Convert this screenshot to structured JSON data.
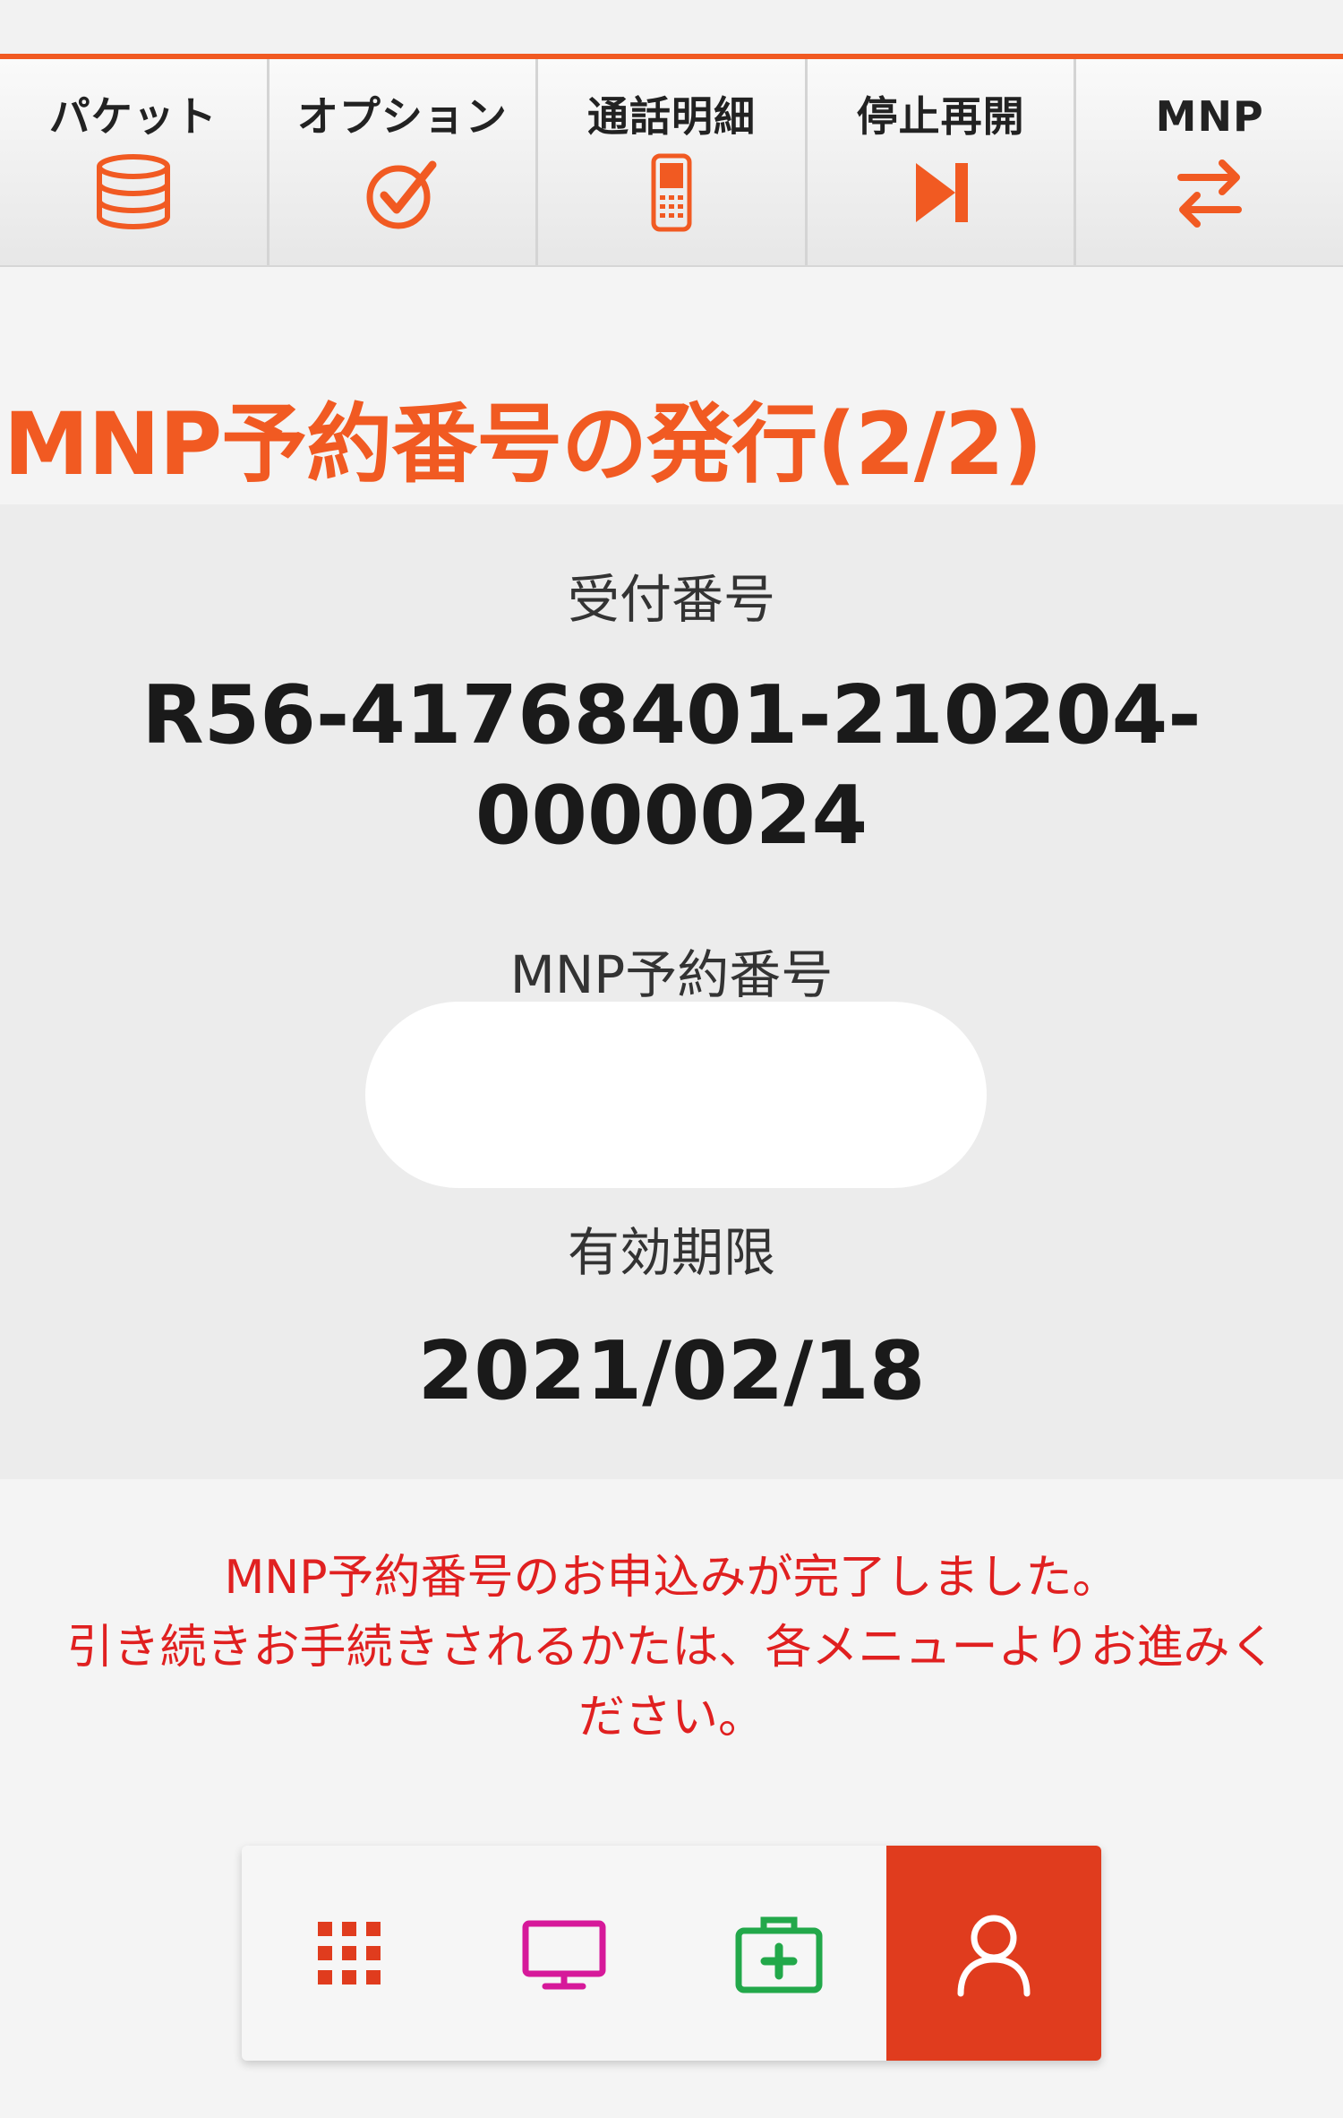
{
  "nav": {
    "items": [
      {
        "label": "パケット",
        "icon": "database-icon"
      },
      {
        "label": "オプション",
        "icon": "check-circle-icon"
      },
      {
        "label": "通話明細",
        "icon": "mobile-phone-icon"
      },
      {
        "label": "停止再開",
        "icon": "play-pause-icon"
      },
      {
        "label": "MNP",
        "icon": "swap-arrows-icon"
      }
    ],
    "accent_color": "#f15a22"
  },
  "page": {
    "title": "MNP予約番号の発行(2/2)"
  },
  "info": {
    "receipt_label": "受付番号",
    "receipt_line1": "R56-41768401-210204-",
    "receipt_line2": "0000024",
    "mnp_label": "MNP予約番号",
    "expiry_label": "有効期限",
    "expiry_value": "2021/02/18"
  },
  "message": {
    "line1": "MNP予約番号のお申込みが完了しました。",
    "line2": "引き続きお手続きされるかたは、各メニューよりお進みく",
    "line3": "ださい。",
    "color": "#e02020"
  },
  "bottom_bar": {
    "items": [
      {
        "icon": "grid-icon",
        "color": "#e03c1e"
      },
      {
        "icon": "monitor-icon",
        "color": "#d6199a"
      },
      {
        "icon": "first-aid-kit-icon",
        "color": "#22a84a"
      },
      {
        "icon": "user-icon",
        "color": "#ffffff",
        "active": true
      }
    ],
    "active_color": "#e03c1e"
  }
}
